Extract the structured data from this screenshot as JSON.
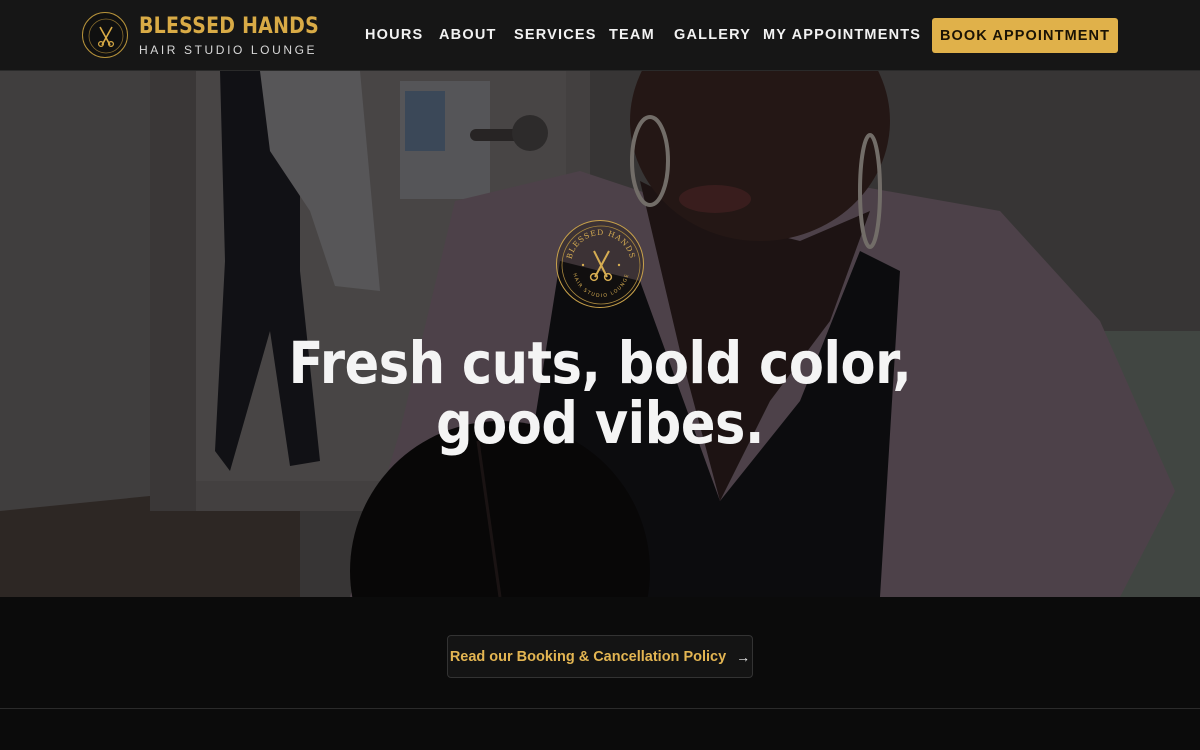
{
  "header": {
    "brand_name": "BLESSED HANDS",
    "brand_tagline": "HAIR STUDIO LOUNGE",
    "nav": [
      {
        "label": "HOURS"
      },
      {
        "label": "ABOUT"
      },
      {
        "label": "SERVICES"
      },
      {
        "label": "TEAM"
      },
      {
        "label": "GALLERY"
      },
      {
        "label": "MY APPOINTMENTS"
      }
    ],
    "cta_label": "BOOK APPOINTMENT"
  },
  "hero": {
    "badge_top_text": "BLESSED HANDS",
    "badge_bottom_text": "HAIR STUDIO LOUNGE",
    "headline": "Fresh cuts, bold color, good vibes."
  },
  "policy": {
    "link_label": "Read our Booking & Cancellation Policy",
    "arrow": "→"
  },
  "icons": {
    "logo": "scissors-comb-icon",
    "policy_arrow": "arrow-right-icon"
  },
  "colors": {
    "accent_gold": "#e0b14a",
    "header_bg": "#161616",
    "page_bg": "#0b0b0b"
  }
}
